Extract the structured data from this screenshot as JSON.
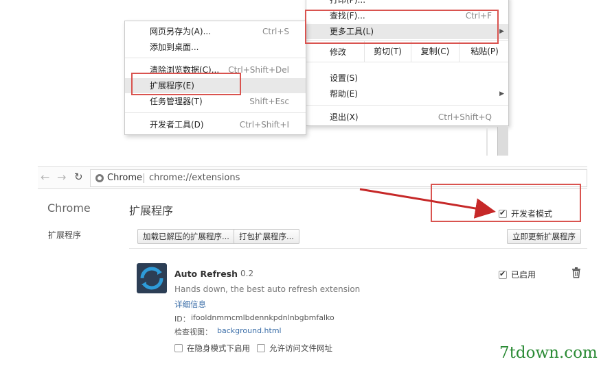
{
  "main_menu": {
    "partial_top": "打印(P)...",
    "find_label": "查找(F)...",
    "find_shortcut": "Ctrl+F",
    "more_tools_label": "更多工具(L)",
    "edit_label": "修改",
    "cut_label": "剪切(T)",
    "copy_label": "复制(C)",
    "paste_label": "粘贴(P)",
    "settings_label": "设置(S)",
    "help_label": "帮助(E)",
    "exit_label": "退出(X)",
    "exit_shortcut": "Ctrl+Shift+Q"
  },
  "more_tools_menu": {
    "items": [
      {
        "label": "网页另存为(A)...",
        "shortcut": "Ctrl+S"
      },
      {
        "label": "添加到桌面...",
        "shortcut": ""
      },
      {
        "label": "清除浏览数据(C)...",
        "shortcut": "Ctrl+Shift+Del"
      },
      {
        "label": "扩展程序(E)",
        "shortcut": ""
      },
      {
        "label": "任务管理器(T)",
        "shortcut": "Shift+Esc"
      },
      {
        "label": "开发者工具(D)",
        "shortcut": "Ctrl+Shift+I"
      }
    ]
  },
  "browser": {
    "site_label": "Chrome",
    "url": "chrome://extensions"
  },
  "sidebar": {
    "title": "Chrome",
    "item": "扩展程序"
  },
  "extensions_page": {
    "title": "扩展程序",
    "developer_mode_label": "开发者模式",
    "developer_mode_checked": true,
    "load_unpacked_button": "加载已解压的扩展程序...",
    "pack_button": "打包扩展程序...",
    "update_button": "立即更新扩展程序"
  },
  "extension": {
    "name": "Auto Refresh",
    "version": "0.2",
    "description": "Hands down, the best auto refresh extension",
    "details_link": "详细信息",
    "id_label": "ID：",
    "id": "ifooldnmmcmlbdennkpdnlnbgbmfalko",
    "inspect_label": "检查视图：",
    "inspect_link": "background.html",
    "enabled_label": "已启用",
    "enabled_checked": true,
    "incognito_label": "在隐身模式下启用",
    "file_urls_label": "允许访问文件网址"
  },
  "watermark": "7tdown.com",
  "colors": {
    "highlight_box": "#d9534f",
    "arrow": "#c62828",
    "link": "#3b6ea8",
    "watermark": "#2a8a34"
  }
}
